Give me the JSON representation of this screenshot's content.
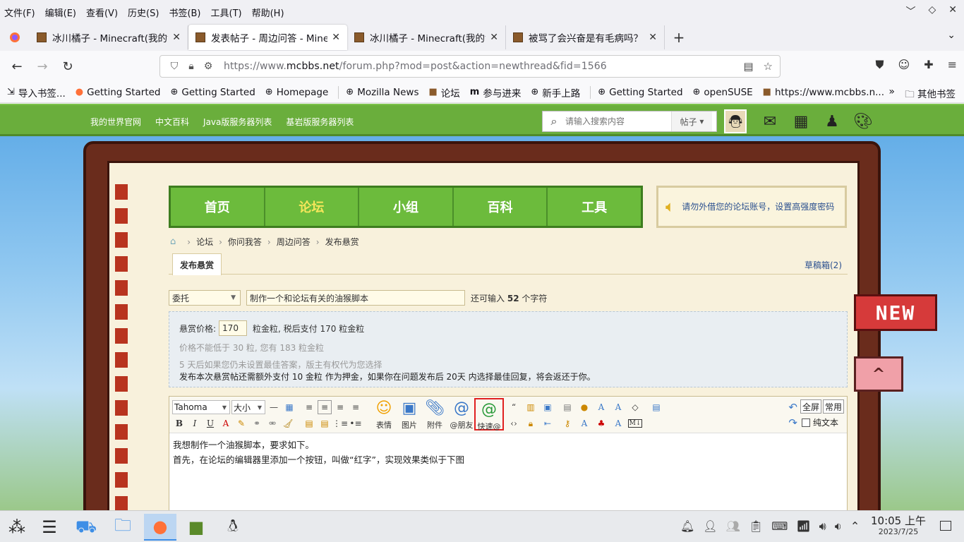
{
  "menu": [
    "文件(F)",
    "编辑(E)",
    "查看(V)",
    "历史(S)",
    "书签(B)",
    "工具(T)",
    "帮助(H)"
  ],
  "window_controls": [
    "﹀",
    "◇",
    "✕"
  ],
  "tabs": [
    {
      "title": "冰川橘子 - Minecraft(我的世",
      "active": false
    },
    {
      "title": "发表帖子 - 周边问答 - Minec",
      "active": true
    },
    {
      "title": "冰川橘子 - Minecraft(我的世",
      "active": false
    },
    {
      "title": "被骂了会兴奋是有毛病吗？",
      "active": false
    }
  ],
  "url": {
    "prefix": "https://www.",
    "domain": "mcbbs.net",
    "path": "/forum.php?mod=post&action=newthread&fid=1566"
  },
  "bookmarks": [
    {
      "icon": "import-icon",
      "label": "导入书签..."
    },
    {
      "icon": "firefox-icon",
      "label": "Getting Started"
    },
    {
      "icon": "globe-icon",
      "label": "Getting Started"
    },
    {
      "icon": "globe-icon",
      "label": "Homepage"
    },
    {
      "icon": "globe-icon",
      "label": "Mozilla News"
    },
    {
      "icon": "mcbbs-icon",
      "label": "论坛"
    },
    {
      "icon": "m-icon",
      "label": "参与进来"
    },
    {
      "icon": "globe-icon",
      "label": "新手上路"
    },
    {
      "icon": "globe-icon",
      "label": "Getting Started"
    },
    {
      "icon": "globe-icon",
      "label": "openSUSE"
    },
    {
      "icon": "mcbbs-icon",
      "label": "https://www.mcbbs.n..."
    }
  ],
  "bookmarks_other": "其他书签",
  "site_nav": [
    "我的世界官网",
    "中文百科",
    "Java版服务器列表",
    "基岩版服务器列表"
  ],
  "search": {
    "placeholder": "请输入搜索内容",
    "scope": "帖子"
  },
  "main_nav": [
    {
      "label": "首页",
      "active": false
    },
    {
      "label": "论坛",
      "active": true
    },
    {
      "label": "小组",
      "active": false
    },
    {
      "label": "百科",
      "active": false
    },
    {
      "label": "工具",
      "active": false
    }
  ],
  "notice": "请勿外借您的论坛账号，设置高强度密码",
  "breadcrumb": [
    "论坛",
    "你问我答",
    "周边问答",
    "发布悬赏"
  ],
  "form_tab": "发布悬赏",
  "drafts": "草稿箱(2)",
  "category": "委托",
  "title_value": "制作一个和论坛有关的油猴脚本",
  "char_count": {
    "pre": "还可输入",
    "num": "52",
    "post": "个字符"
  },
  "reward": {
    "label": "悬赏价格:",
    "price": "170",
    "after": "粒金粒, 税后支付 170 粒金粒",
    "min_note": "价格不能低于 30 粒, 您有 183 粒金粒",
    "note2": "5 天后如果您仍未设置最佳答案，版主有权代为您选择",
    "note3": "发布本次悬赏帖还需额外支付 10 金粒 作为押金，如果你在问题发布后 20天 内选择最佳回复，将会返还于你。"
  },
  "editor": {
    "font": "Tahoma",
    "size": "大小",
    "buttons": [
      "表情",
      "图片",
      "附件",
      "@朋友",
      "快速@"
    ],
    "fullscreen": "全屏",
    "common": "常用",
    "plaintext": "纯文本",
    "lines": [
      "我想制作一个油猴脚本，要求如下。",
      "首先，在论坛的编辑器里添加一个按钮，叫做“红字”，实现效果类似于下图"
    ]
  },
  "ribbons": {
    "new": "NEW",
    "up": "^"
  },
  "clock": {
    "time": "10:05 上午",
    "date": "2023/7/25"
  },
  "accent_colors": {
    "site_green": "#6aae3c",
    "book_brown": "#6a2c1c",
    "highlight_red": "#e02020"
  }
}
